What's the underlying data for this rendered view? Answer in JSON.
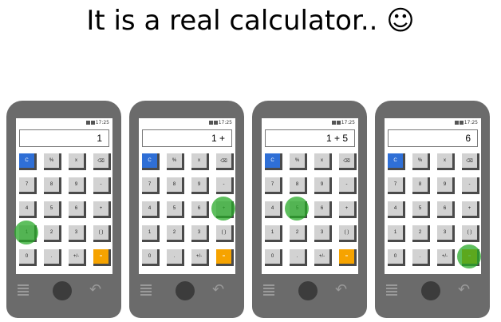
{
  "title": "It is a real calculator.. ☺",
  "status_time": "17:25",
  "keys": [
    {
      "label": "C",
      "kind": "blue"
    },
    {
      "label": "%",
      "kind": "gray"
    },
    {
      "label": "x",
      "kind": "gray"
    },
    {
      "label": "⌫",
      "kind": "gray"
    },
    {
      "label": "7",
      "kind": "gray"
    },
    {
      "label": "8",
      "kind": "gray"
    },
    {
      "label": "9",
      "kind": "gray"
    },
    {
      "label": "-",
      "kind": "gray"
    },
    {
      "label": "4",
      "kind": "gray"
    },
    {
      "label": "5",
      "kind": "gray"
    },
    {
      "label": "6",
      "kind": "gray"
    },
    {
      "label": "+",
      "kind": "gray"
    },
    {
      "label": "1",
      "kind": "gray"
    },
    {
      "label": "2",
      "kind": "gray"
    },
    {
      "label": "3",
      "kind": "gray"
    },
    {
      "label": "( )",
      "kind": "gray"
    },
    {
      "label": "0",
      "kind": "gray"
    },
    {
      "label": ".",
      "kind": "gray"
    },
    {
      "label": "+/-",
      "kind": "gray"
    },
    {
      "label": "=",
      "kind": "orange"
    }
  ],
  "phones": [
    {
      "display": "1",
      "tapped_key": "1"
    },
    {
      "display": "1 +",
      "tapped_key": "+"
    },
    {
      "display": "1 + 5",
      "tapped_key": "5"
    },
    {
      "display": "6",
      "tapped_key": "="
    }
  ],
  "colors": {
    "blue_key": "#2f6fd6",
    "orange_key": "#f6a300",
    "tap_marker": "#28aa28",
    "phone_body": "#6b6b6b"
  }
}
